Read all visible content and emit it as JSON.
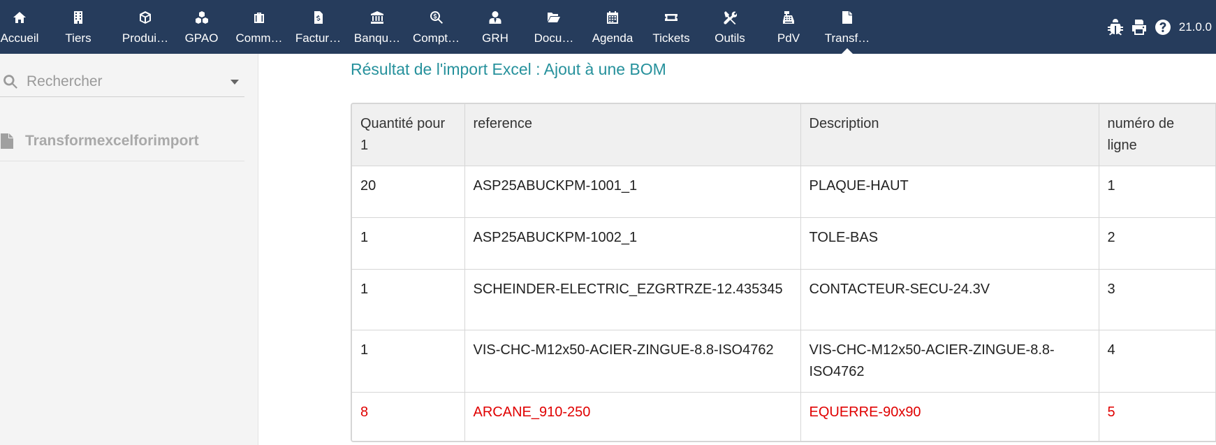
{
  "nav": {
    "items": [
      {
        "label": "Accueil",
        "icon": "home-icon"
      },
      {
        "label": "Tiers",
        "icon": "building-icon"
      },
      {
        "label": "Produi…",
        "icon": "cube-icon"
      },
      {
        "label": "GPAO",
        "icon": "cubes-icon"
      },
      {
        "label": "Comm…",
        "icon": "suitcase-icon"
      },
      {
        "label": "Factur…",
        "icon": "invoice-icon"
      },
      {
        "label": "Banqu…",
        "icon": "bank-icon"
      },
      {
        "label": "Compt…",
        "icon": "search-dollar-icon"
      },
      {
        "label": "GRH",
        "icon": "user-tie-icon"
      },
      {
        "label": "Docu…",
        "icon": "folder-open-icon"
      },
      {
        "label": "Agenda",
        "icon": "calendar-icon"
      },
      {
        "label": "Tickets",
        "icon": "ticket-icon"
      },
      {
        "label": "Outils",
        "icon": "tools-icon"
      },
      {
        "label": "PdV",
        "icon": "cash-register-icon"
      },
      {
        "label": "Transf…",
        "icon": "file-icon"
      }
    ],
    "active_index": 14,
    "version": "21.0.0"
  },
  "sidebar": {
    "search_placeholder": "Rechercher",
    "entry_label": "Transformexcelforimport"
  },
  "main": {
    "title": "Résultat de l'import Excel : Ajout à une BOM",
    "table": {
      "headers": [
        "Quantité pour 1",
        "reference",
        "Description",
        "numéro de ligne"
      ],
      "rows": [
        [
          "20",
          "ASP25ABUCKPM-1001_1",
          "PLAQUE-HAUT",
          "1"
        ],
        [
          "1",
          "ASP25ABUCKPM-1002_1",
          "TOLE-BAS",
          "2"
        ],
        [
          "1",
          "SCHEINDER-ELECTRIC_EZGRTRZE-12.435345",
          "CONTACTEUR-SECU-24.3V",
          "3"
        ],
        [
          "1",
          "VIS-CHC-M12x50-ACIER-ZINGUE-8.8-ISO4762",
          "VIS-CHC-M12x50-ACIER-ZINGUE-8.8-ISO4762",
          "4"
        ],
        [
          "8",
          "ARCANE_910-250",
          "EQUERRE-90x90",
          "5"
        ]
      ],
      "error_row_color": "#e00000"
    }
  },
  "colors": {
    "topbar": "#263c5c",
    "title": "#26919c"
  }
}
